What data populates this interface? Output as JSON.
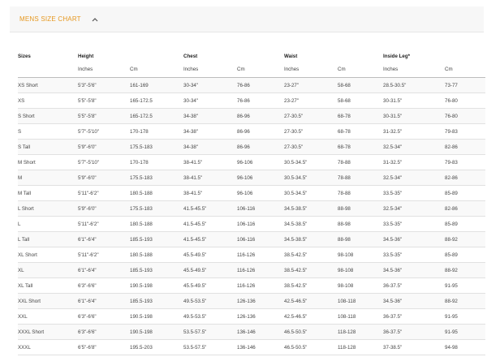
{
  "section": {
    "title": "MENS SIZE CHART",
    "chevron_icon": "chevron-up-icon",
    "accent": "#e6981f"
  },
  "table": {
    "group_headers": [
      "Sizes",
      "Height",
      "Chest",
      "Waist",
      "Inside Leg*"
    ],
    "sub_headers": [
      "",
      "Inches",
      "Cm",
      "Inches",
      "Cm",
      "Inches",
      "Cm",
      "Inches",
      "Cm"
    ],
    "rows": [
      [
        "XS Short",
        "5'3\"-5'6\"",
        "161-169",
        "30-34\"",
        "76-86",
        "23-27\"",
        "58-68",
        "28.5-30.5\"",
        "73-77"
      ],
      [
        "XS",
        "5'5\"-5'8\"",
        "165-172.5",
        "30-34\"",
        "76-86",
        "23-27\"",
        "58-68",
        "30-31.5\"",
        "76-80"
      ],
      [
        "S Short",
        "5'5\"-5'8\"",
        "165-172.5",
        "34-38\"",
        "86-96",
        "27-30.5\"",
        "68-78",
        "30-31.5\"",
        "76-80"
      ],
      [
        "S",
        "5'7\"-5'10\"",
        "170-178",
        "34-38\"",
        "86-96",
        "27-30.5\"",
        "68-78",
        "31-32.5\"",
        "79-83"
      ],
      [
        "S Tall",
        "5'9\"-6'0\"",
        "175.5-183",
        "34-38\"",
        "86-96",
        "27-30.5\"",
        "68-78",
        "32.5-34\"",
        "82-86"
      ],
      [
        "M Short",
        "5'7\"-5'10\"",
        "170-178",
        "38-41.5\"",
        "96-106",
        "30.5-34.5\"",
        "78-88",
        "31-32.5\"",
        "79-83"
      ],
      [
        "M",
        "5'9\"-6'0\"",
        "175.5-183",
        "38-41.5\"",
        "96-106",
        "30.5-34.5\"",
        "78-88",
        "32.5-34\"",
        "82-86"
      ],
      [
        "M Tall",
        "5'11\"-6'2\"",
        "180.5-188",
        "38-41.5\"",
        "96-106",
        "30.5-34.5\"",
        "78-88",
        "33.5-35\"",
        "85-89"
      ],
      [
        "L Short",
        "5'9\"-6'0\"",
        "175.5-183",
        "41.5-45.5\"",
        "106-116",
        "34.5-38.5\"",
        "88-98",
        "32.5-34\"",
        "82-86"
      ],
      [
        "L",
        "5'11\"-6'2\"",
        "180.5-188",
        "41.5-45.5\"",
        "106-116",
        "34.5-38.5\"",
        "88-98",
        "33.5-35\"",
        "85-89"
      ],
      [
        "L Tall",
        "6'1\"-6'4\"",
        "185.5-193",
        "41.5-45.5\"",
        "106-116",
        "34.5-38.5\"",
        "88-98",
        "34.5-36\"",
        "88-92"
      ],
      [
        "XL Short",
        "5'11\"-6'2\"",
        "180.5-188",
        "45.5-49.5\"",
        "116-126",
        "38.5-42.5\"",
        "98-108",
        "33.5-35\"",
        "85-89"
      ],
      [
        "XL",
        "6'1\"-6'4\"",
        "185.5-193",
        "45.5-49.5\"",
        "116-126",
        "38.5-42.5\"",
        "98-108",
        "34.5-36\"",
        "88-92"
      ],
      [
        "XL Tall",
        "6'3\"-6'6\"",
        "190.5-198",
        "45.5-49.5\"",
        "116-126",
        "38.5-42.5\"",
        "98-108",
        "36-37.5\"",
        "91-95"
      ],
      [
        "XXL Short",
        "6'1\"-6'4\"",
        "185.5-193",
        "49.5-53.5\"",
        "126-136",
        "42.5-46.5\"",
        "108-118",
        "34.5-36\"",
        "88-92"
      ],
      [
        "XXL",
        "6'3\"-6'6\"",
        "190.5-198",
        "49.5-53.5\"",
        "126-136",
        "42.5-46.5\"",
        "108-118",
        "36-37.5\"",
        "91-95"
      ],
      [
        "XXXL Short",
        "6'3\"-6'6\"",
        "190.5-198",
        "53.5-57.5\"",
        "136-146",
        "46.5-50.5\"",
        "118-128",
        "36-37.5\"",
        "91-95"
      ],
      [
        "XXXL",
        "6'5\"-6'8\"",
        "195.5-203",
        "53.5-57.5\"",
        "136-146",
        "46.5-50.5\"",
        "118-128",
        "37-38.5\"",
        "94-98"
      ]
    ]
  }
}
